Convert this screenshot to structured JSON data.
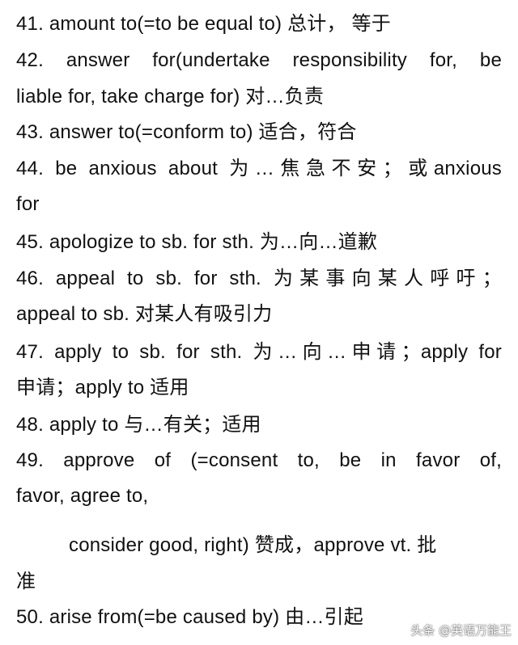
{
  "lines": [
    "41. amount to(=to be equal to) 总计，  等于",
    "42. answer for(undertake responsibility for, be",
    "liable for, take charge for) 对…负责",
    "43. answer to(=conform to) 适合，符合",
    "44. be anxious about 为…焦急不安；或anxious",
    "for",
    "45. apologize to sb. for sth. 为…向…道歉",
    "46. appeal to sb. for sth. 为某事向某人呼吁；",
    "appeal to sb. 对某人有吸引力",
    "47. apply to sb. for sth. 为…向…申请；apply for",
    "申请；apply to 适用",
    "48. apply to 与…有关；适用",
    "49. approve of (=consent to, be in favor of,",
    "favor, agree to,",
    "consider good, right) 赞成，approve vt. 批",
    "准",
    "50. arise from(=be caused by) 由…引起"
  ],
  "watermark": {
    "text": "头条 @英语万能王"
  }
}
